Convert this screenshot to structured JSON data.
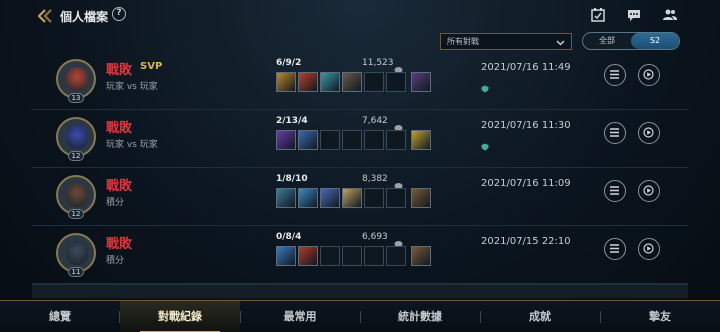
{
  "header": {
    "title": "個人檔案",
    "help": "?"
  },
  "filter": {
    "selected": "所有對戰"
  },
  "segment": {
    "all": "全部",
    "season": "S2"
  },
  "matches": [
    {
      "result": "戰敗",
      "badge": "SVP",
      "mode": "玩家 vs 玩家",
      "level": "13",
      "kda": "6/9/2",
      "gold": "11,523",
      "date": "2021/07/16 11:49",
      "avatar_color": "#b4463a",
      "items": [
        "#c08a2a",
        "#b8402a",
        "#3a9aa8",
        "#6a5a4a",
        "",
        ""
      ],
      "trinket": "#5a3f7a",
      "shield": true
    },
    {
      "result": "戰敗",
      "badge": "",
      "mode": "玩家 vs 玩家",
      "level": "12",
      "kda": "2/13/4",
      "gold": "7,642",
      "date": "2021/07/16 11:30",
      "avatar_color": "#3a4ab0",
      "items": [
        "#6a3aa8",
        "#3a6ab0",
        "",
        "",
        "",
        ""
      ],
      "trinket": "#c0a030",
      "shield": true
    },
    {
      "result": "戰敗",
      "badge": "",
      "mode": "積分",
      "level": "12",
      "kda": "1/8/10",
      "gold": "8,382",
      "date": "2021/07/16 11:09",
      "avatar_color": "#6a4a3a",
      "items": [
        "#3a7a9a",
        "#3a8ac0",
        "#4a6ab8",
        "#c0a060",
        "",
        ""
      ],
      "trinket": "#7a5a3a",
      "shield": false
    },
    {
      "result": "戰敗",
      "badge": "",
      "mode": "積分",
      "level": "11",
      "kda": "0/8/4",
      "gold": "6,693",
      "date": "2021/07/15 22:10",
      "avatar_color": "#3a4a5a",
      "items": [
        "#3a7ac0",
        "#b03a2a",
        "",
        "",
        "",
        ""
      ],
      "trinket": "#7a5a3a",
      "shield": false
    }
  ],
  "nav": {
    "tabs": [
      "總覽",
      "對戰紀錄",
      "最常用",
      "統計數據",
      "成就",
      "摯友"
    ],
    "active": "對戰紀錄"
  }
}
